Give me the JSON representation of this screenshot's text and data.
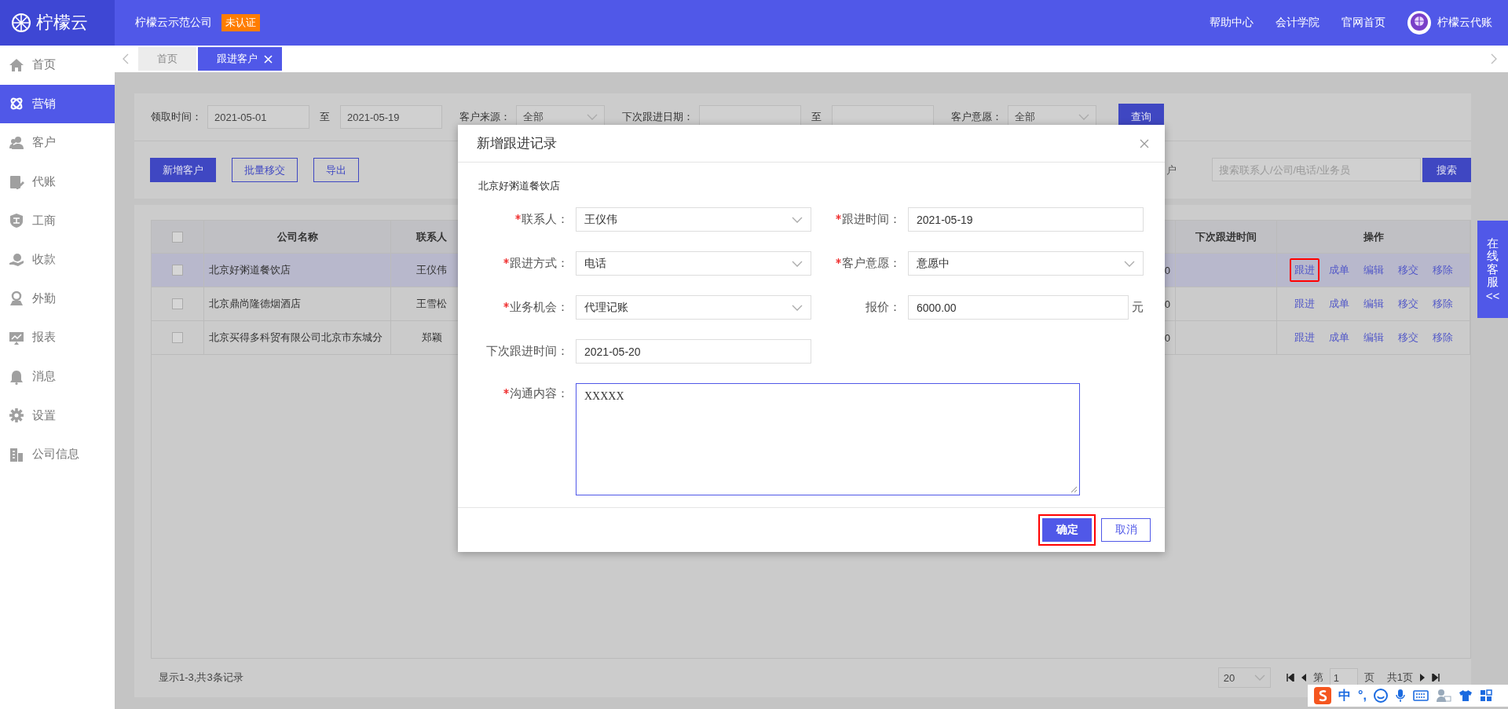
{
  "header": {
    "brand": "柠檬云",
    "company": "柠檬云示范公司",
    "badge": "未认证",
    "links": [
      "帮助中心",
      "会计学院",
      "官网首页"
    ],
    "account": "柠檬云代账"
  },
  "sidebar": {
    "items": [
      {
        "label": "首页",
        "selected": false
      },
      {
        "label": "营销",
        "selected": true
      },
      {
        "label": "客户",
        "selected": false
      },
      {
        "label": "代账",
        "selected": false
      },
      {
        "label": "工商",
        "selected": false
      },
      {
        "label": "收款",
        "selected": false
      },
      {
        "label": "外勤",
        "selected": false
      },
      {
        "label": "报表",
        "selected": false
      },
      {
        "label": "消息",
        "selected": false
      },
      {
        "label": "设置",
        "selected": false
      },
      {
        "label": "公司信息",
        "selected": false
      }
    ]
  },
  "tabs": [
    {
      "label": "首页",
      "selected": false,
      "closable": false
    },
    {
      "label": "跟进客户",
      "selected": true,
      "closable": true
    }
  ],
  "filters": [
    {
      "kind": "date-range",
      "label": "领取时间：",
      "from": "2021-05-01",
      "sep": "至",
      "to": "2021-05-19"
    },
    {
      "kind": "select",
      "label": "客户来源：",
      "value": "全部"
    },
    {
      "kind": "date-range",
      "label": "下次跟进日期：",
      "sep": "至"
    },
    {
      "kind": "select",
      "label": "客户意愿：",
      "value": "全部"
    }
  ],
  "query_button": "查询",
  "toolbar": {
    "buttons": [
      {
        "label": "新增客户",
        "primary": true
      },
      {
        "label": "批量移交",
        "primary": false
      },
      {
        "label": "导出",
        "primary": false
      }
    ],
    "label_fragment": "户",
    "search_placeholder": "搜索联系人/公司/电话/业务员",
    "search_button": "搜索"
  },
  "table": {
    "select_all_checked": false,
    "columns": [
      "公司名称",
      "联系人",
      "下次跟进时间",
      "操作"
    ],
    "rows": [
      {
        "selected": true,
        "checked": false,
        "company": "北京好粥道餐饮店",
        "contact": "王仪伟",
        "column_partial": "0",
        "actions": [
          {
            "label": "跟进",
            "highlighted": true
          },
          {
            "label": "成单",
            "highlighted": false
          },
          {
            "label": "编辑",
            "highlighted": false
          },
          {
            "label": "移交",
            "highlighted": false
          },
          {
            "label": "移除",
            "highlighted": false
          }
        ]
      },
      {
        "selected": false,
        "checked": false,
        "company": "北京鼎尚隆德烟酒店",
        "contact": "王雪松",
        "column_partial": "0",
        "actions": [
          {
            "label": "跟进",
            "highlighted": false
          },
          {
            "label": "成单",
            "highlighted": false
          },
          {
            "label": "编辑",
            "highlighted": false
          },
          {
            "label": "移交",
            "highlighted": false
          },
          {
            "label": "移除",
            "highlighted": false
          }
        ]
      },
      {
        "selected": false,
        "checked": false,
        "company": "北京买得多科贸有限公司北京市东城分",
        "contact": "郑颖",
        "column_partial": "0",
        "actions": [
          {
            "label": "跟进",
            "highlighted": false
          },
          {
            "label": "成单",
            "highlighted": false
          },
          {
            "label": "编辑",
            "highlighted": false
          },
          {
            "label": "移交",
            "highlighted": false
          },
          {
            "label": "移除",
            "highlighted": false
          }
        ]
      }
    ]
  },
  "pagination": {
    "summary": "显示1-3,共3条记录",
    "page_size": "20",
    "page_prefix": "第",
    "page": "1",
    "page_suffix": "页",
    "total_pages": "共1页"
  },
  "service_tab": {
    "label": "在线客服",
    "arrow": "<<"
  },
  "modal": {
    "title": "新增跟进记录",
    "subject": "北京好粥道餐饮店",
    "fields": [
      {
        "kind": "select",
        "label": "联系人：",
        "required": true,
        "value": "王仪伟"
      },
      {
        "kind": "input",
        "label": "跟进时间：",
        "required": true,
        "value": "2021-05-19"
      },
      {
        "kind": "select",
        "label": "跟进方式：",
        "required": true,
        "value": "电话"
      },
      {
        "kind": "select",
        "label": "客户意愿：",
        "required": true,
        "value": "意愿中"
      },
      {
        "kind": "select",
        "label": "业务机会：",
        "required": true,
        "value": "代理记账"
      },
      {
        "kind": "input",
        "label": "报价：",
        "required": false,
        "value": "6000.00",
        "suffix": "元"
      },
      {
        "kind": "input",
        "label": "下次跟进时间：",
        "required": false,
        "value": "2021-05-20"
      },
      {
        "kind": "textarea",
        "label": "沟通内容：",
        "required": true,
        "value": "XXXXX",
        "focused": true
      }
    ],
    "buttons": [
      {
        "label": "确定",
        "primary": true,
        "highlighted": true
      },
      {
        "label": "取消",
        "primary": false,
        "highlighted": false
      }
    ]
  },
  "ime_bar": {
    "mode": "中",
    "punct": "°,"
  }
}
